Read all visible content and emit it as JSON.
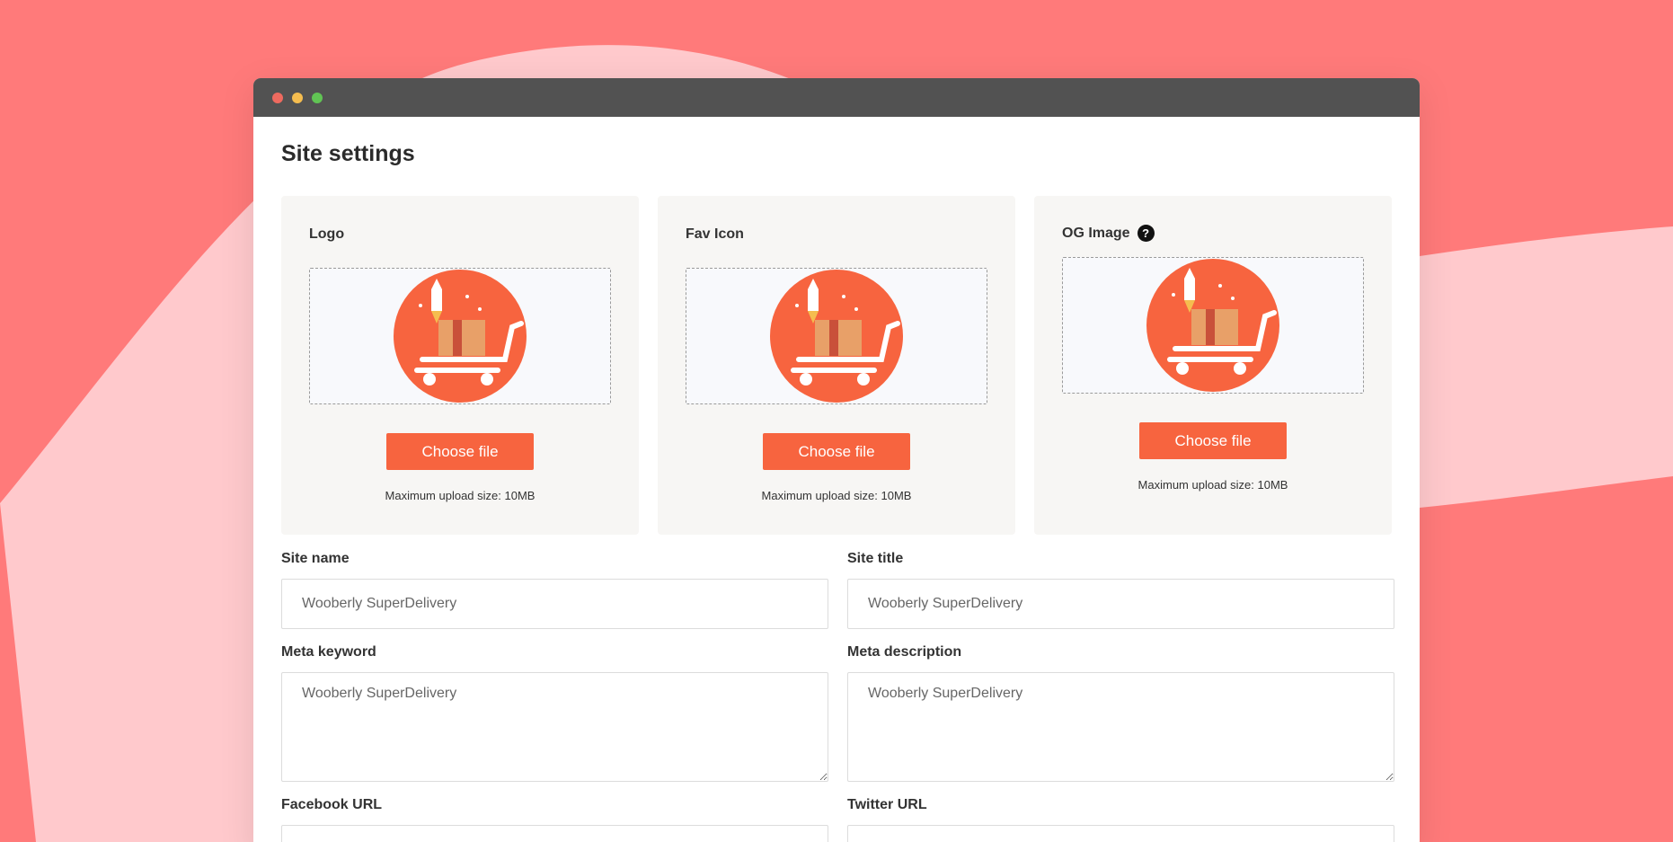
{
  "colors": {
    "background": "#ff7a7a",
    "background_light": "#ffc9cc",
    "titlebar": "#525252",
    "accent": "#f7643f",
    "card_bg": "#f7f6f4",
    "traffic_red": "#ee6a5f",
    "traffic_yellow": "#f5bd4f",
    "traffic_green": "#61c454"
  },
  "window": {
    "controls": [
      "close",
      "minimize",
      "maximize"
    ]
  },
  "page": {
    "title": "Site settings"
  },
  "uploads": [
    {
      "label": "Logo",
      "button": "Choose file",
      "note": "Maximum upload size: 10MB",
      "image": "delivery-cart-logo"
    },
    {
      "label": "Fav Icon",
      "button": "Choose file",
      "note": "Maximum upload size: 10MB",
      "image": "delivery-cart-logo"
    },
    {
      "label": "OG Image",
      "help_icon": "?",
      "button": "Choose file",
      "note": "Maximum upload size: 10MB",
      "image": "delivery-cart-logo"
    }
  ],
  "form": {
    "site_name": {
      "label": "Site name",
      "value": "Wooberly SuperDelivery"
    },
    "site_title": {
      "label": "Site title",
      "value": "Wooberly SuperDelivery"
    },
    "meta_keyword": {
      "label": "Meta keyword",
      "value": "Wooberly SuperDelivery"
    },
    "meta_description": {
      "label": "Meta description",
      "value": "Wooberly SuperDelivery"
    },
    "facebook_url": {
      "label": "Facebook URL",
      "value": ""
    },
    "twitter_url": {
      "label": "Twitter URL",
      "value": ""
    }
  }
}
